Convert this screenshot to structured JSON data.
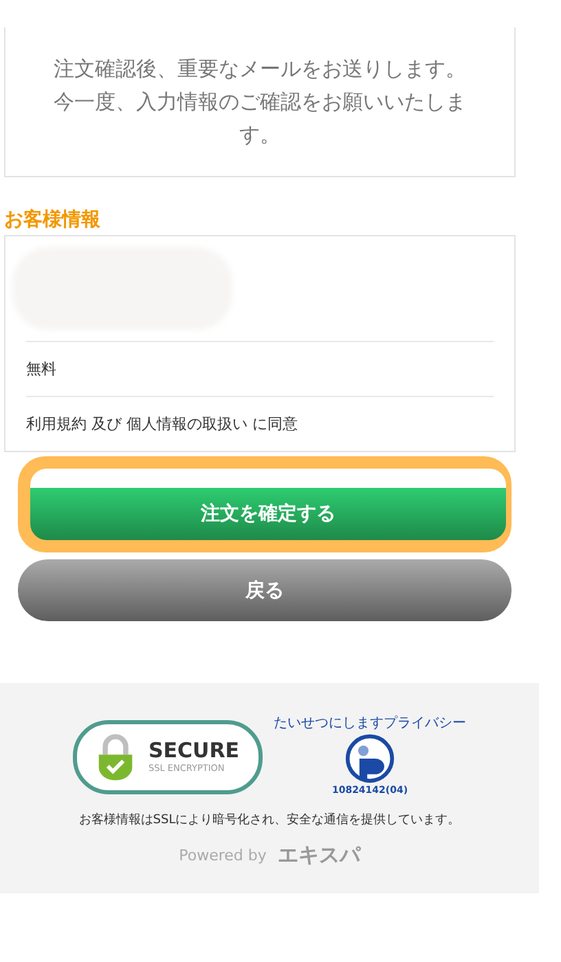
{
  "notice": {
    "text": "注文確認後、重要なメールをお送りします。今一度、入力情報のご確認をお願いいたします。"
  },
  "customer_section": {
    "title": "お客様情報",
    "rows": [
      {
        "kind": "redacted"
      },
      {
        "kind": "text",
        "text": "無料"
      },
      {
        "kind": "text",
        "text": "利用規約 及び 個人情報の取扱い に同意"
      }
    ]
  },
  "buttons": [
    {
      "kind": "primary",
      "label": "注文を確定する",
      "focused": true
    },
    {
      "kind": "secondary",
      "label": "戻る",
      "focused": false
    }
  ],
  "footer": {
    "secure_badge": {
      "title": "SECURE",
      "subtitle": "SSL ENCRYPTION"
    },
    "privacy_mark": {
      "caption": "たいせつにしますプライバシー",
      "number": "10824142(04)"
    },
    "note": "お客様情報はSSLにより暗号化され、安全な通信を提供しています。",
    "powered_by": "Powered by",
    "brand": "エキスパ"
  }
}
